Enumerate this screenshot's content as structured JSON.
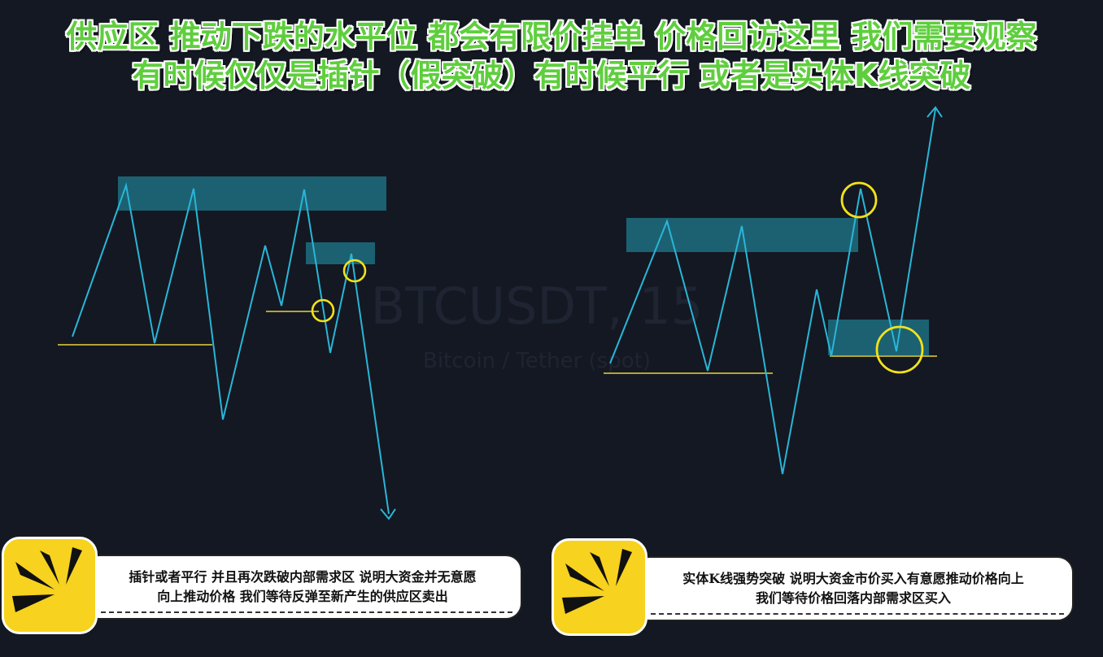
{
  "header": {
    "line1": "供应区 推动下跌的水平位 都会有限价挂单 价格回访这里 我们需要观察",
    "line2": "有时候仅仅是插针（假突破）有时候平行 或者是实体K线突破"
  },
  "watermark": {
    "symbol": "BTCUSDT, 15",
    "pair": "Bitcoin / Tether (spot)"
  },
  "colors": {
    "background": "#141822",
    "price_line": "#29b6d8",
    "zone": "#1d6e80",
    "level_line": "#e8d23c",
    "highlight_circle": "#f2e21a",
    "title_green": "#5fce3e",
    "badge_yellow": "#f7d21e"
  },
  "callouts": [
    {
      "icon": "megaphone-burst-icon",
      "line1": "插针或者平行 并且再次跌破内部需求区 说明大资金并无意愿",
      "line2": "向上推动价格 我们等待反弹至新产生的供应区卖出"
    },
    {
      "icon": "megaphone-burst-icon",
      "line1": "实体K线强势突破 说明大资金市价买入有意愿推动价格向上",
      "line2": "我们等待价格回落内部需求区买入"
    }
  ]
}
